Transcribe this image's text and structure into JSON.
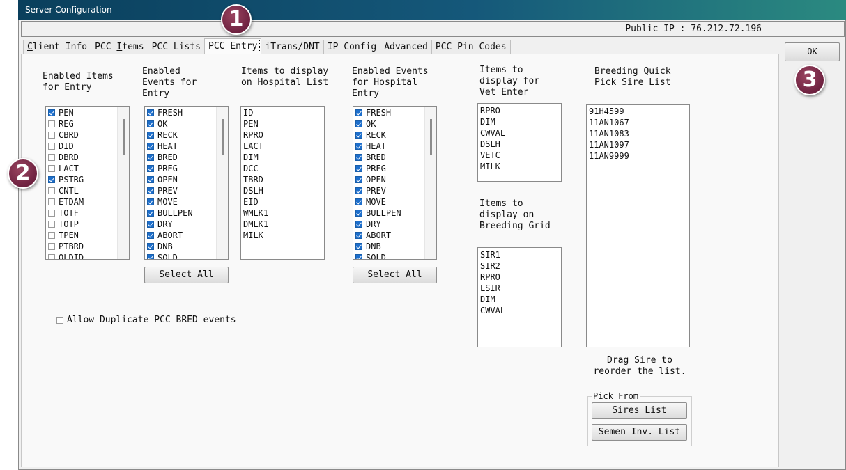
{
  "window": {
    "title": "Server Configuration"
  },
  "public_ip": "Public IP : 76.212.72.196",
  "tabs": [
    {
      "pre": "",
      "u": "C",
      "post": "lient Info",
      "active": false,
      "name": "tab-client-info"
    },
    {
      "pre": "PCC ",
      "u": "I",
      "post": "tems",
      "active": false,
      "name": "tab-pcc-items"
    },
    {
      "pre": "PCC Lists",
      "u": "",
      "post": "",
      "active": false,
      "name": "tab-pcc-lists"
    },
    {
      "pre": "PCC Entry",
      "u": "",
      "post": "",
      "active": true,
      "name": "tab-pcc-entry"
    },
    {
      "pre": "iTrans/DNT",
      "u": "",
      "post": "",
      "active": false,
      "name": "tab-itrans-dnt"
    },
    {
      "pre": "IP Config",
      "u": "",
      "post": "",
      "active": false,
      "name": "tab-ip-config"
    },
    {
      "pre": "Advanced",
      "u": "",
      "post": "",
      "active": false,
      "name": "tab-advanced"
    },
    {
      "pre": "PCC Pin Codes",
      "u": "",
      "post": "",
      "active": false,
      "name": "tab-pcc-pin-codes"
    }
  ],
  "ok_button": "OK",
  "badges": {
    "one": "1",
    "two": "2",
    "three": "3"
  },
  "labels": {
    "enabled_items": "Enabled Items\nfor Entry",
    "enabled_events": "Enabled\nEvents for\nEntry",
    "hospital_list": "Items to display\non Hospital List",
    "hospital_events": "Enabled Events\nfor Hospital\nEntry",
    "vet_enter": "Items to\ndisplay for\nVet Enter",
    "breeding_grid": "Items to\ndisplay on\nBreeding Grid",
    "sire_list": "Breeding Quick\nPick Sire List",
    "drag_hint": "Drag Sire to\nreorder the list."
  },
  "enabled_items": [
    {
      "label": "PEN",
      "checked": true
    },
    {
      "label": "REG",
      "checked": false
    },
    {
      "label": "CBRD",
      "checked": false
    },
    {
      "label": "DID",
      "checked": false
    },
    {
      "label": "DBRD",
      "checked": false
    },
    {
      "label": "LACT",
      "checked": false
    },
    {
      "label": "PSTRG",
      "checked": true
    },
    {
      "label": "CNTL",
      "checked": false
    },
    {
      "label": "ETDAM",
      "checked": false
    },
    {
      "label": "TOTF",
      "checked": false
    },
    {
      "label": "TOTP",
      "checked": false
    },
    {
      "label": "TPEN",
      "checked": false
    },
    {
      "label": "PTBRD",
      "checked": false
    },
    {
      "label": "OLDID",
      "checked": false
    }
  ],
  "enabled_events": [
    {
      "label": "FRESH",
      "checked": true
    },
    {
      "label": "OK",
      "checked": true
    },
    {
      "label": "RECK",
      "checked": true
    },
    {
      "label": "HEAT",
      "checked": true
    },
    {
      "label": "BRED",
      "checked": true
    },
    {
      "label": "PREG",
      "checked": true
    },
    {
      "label": "OPEN",
      "checked": true
    },
    {
      "label": "PREV",
      "checked": true
    },
    {
      "label": "MOVE",
      "checked": true
    },
    {
      "label": "BULLPEN",
      "checked": true
    },
    {
      "label": "DRY",
      "checked": true
    },
    {
      "label": "ABORT",
      "checked": true
    },
    {
      "label": "DNB",
      "checked": true
    },
    {
      "label": "SOLD",
      "checked": true
    }
  ],
  "hospital_items": [
    "ID",
    "PEN",
    "RPRO",
    "LACT",
    "DIM",
    "DCC",
    "TBRD",
    "DSLH",
    "EID",
    "WMLK1",
    "DMLK1",
    "MILK"
  ],
  "hospital_events": [
    {
      "label": "FRESH",
      "checked": true
    },
    {
      "label": "OK",
      "checked": true
    },
    {
      "label": "RECK",
      "checked": true
    },
    {
      "label": "HEAT",
      "checked": true
    },
    {
      "label": "BRED",
      "checked": true
    },
    {
      "label": "PREG",
      "checked": true
    },
    {
      "label": "OPEN",
      "checked": true
    },
    {
      "label": "PREV",
      "checked": true
    },
    {
      "label": "MOVE",
      "checked": true
    },
    {
      "label": "BULLPEN",
      "checked": true
    },
    {
      "label": "DRY",
      "checked": true
    },
    {
      "label": "ABORT",
      "checked": true
    },
    {
      "label": "DNB",
      "checked": true
    },
    {
      "label": "SOLD",
      "checked": true
    }
  ],
  "vet_items": [
    "RPRO",
    "DIM",
    "CWVAL",
    "DSLH",
    "VETC",
    "MILK"
  ],
  "breeding_grid_items": [
    "SIR1",
    "SIR2",
    "RPRO",
    "LSIR",
    "DIM",
    "CWVAL"
  ],
  "sires": [
    "91H4599",
    "11AN1067",
    "11AN1083",
    "11AN1097",
    "11AN9999"
  ],
  "buttons": {
    "select_all_1": "Select All",
    "select_all_2": "Select All",
    "sires_list": "Sires List",
    "semen_inv_list": "Semen Inv. List"
  },
  "pick_from": "Pick From",
  "allow_duplicate": {
    "label": "Allow Duplicate PCC BRED events",
    "checked": false
  },
  "colors": {
    "title_start": "#0a3f5c",
    "title_end": "#2b8a80",
    "badge": "#7a2a48",
    "check": "#1e6fcc"
  }
}
